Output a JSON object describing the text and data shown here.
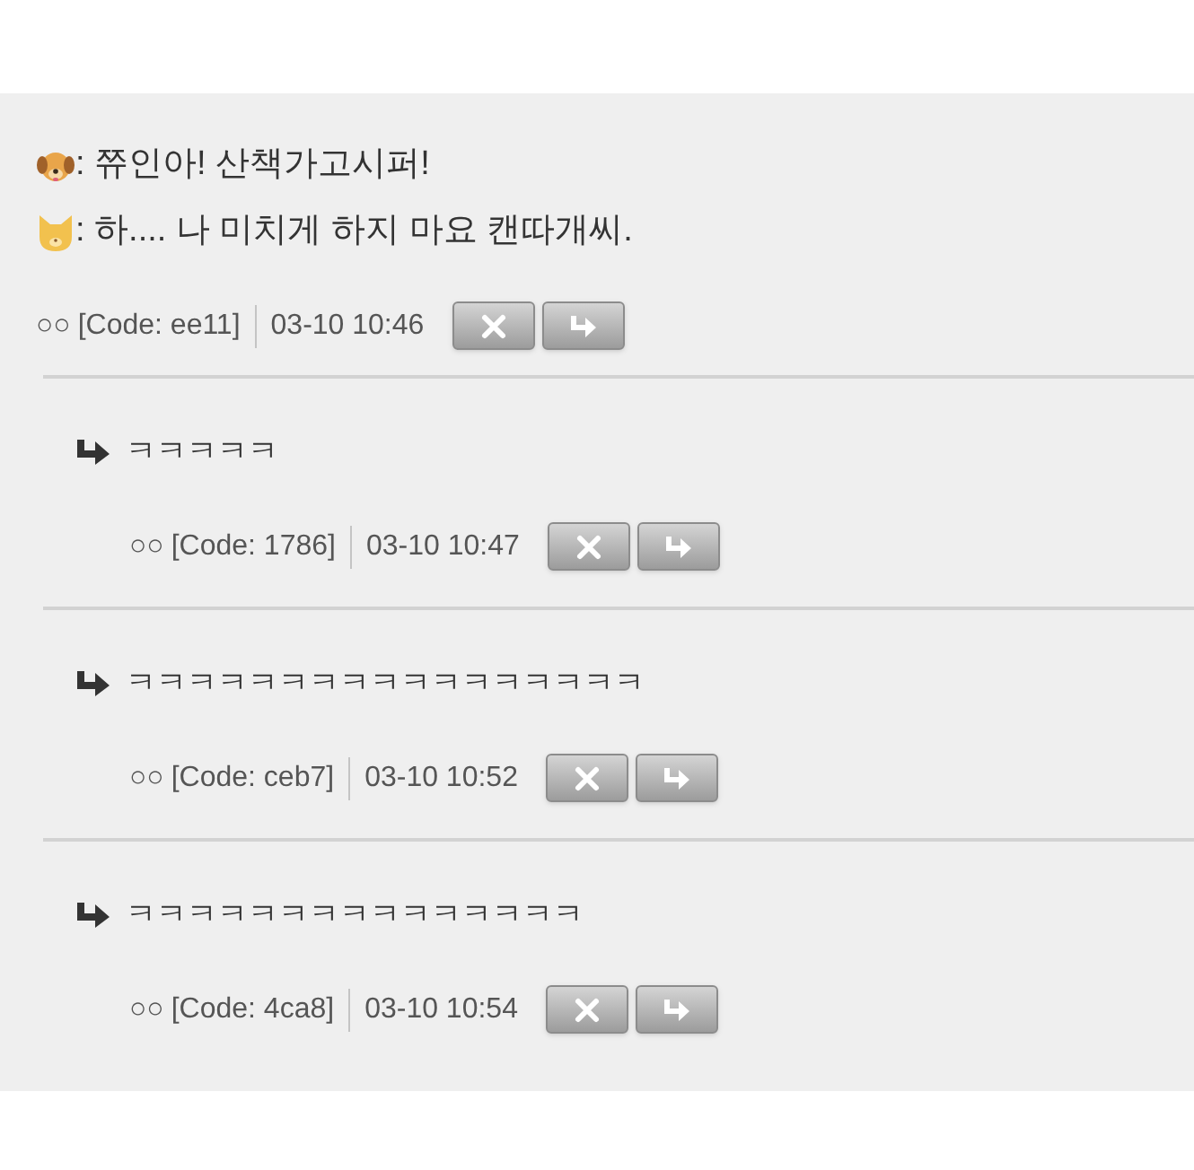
{
  "post": {
    "lines": [
      {
        "kind": "dog",
        "text": ": 쮸인아! 산책가고시퍼!"
      },
      {
        "kind": "cat",
        "text": ": 하.... 나 미치게 하지 마요 캔따개씨."
      }
    ],
    "author": "○○",
    "code": "[Code: ee11]",
    "time": "03-10 10:46"
  },
  "replies": [
    {
      "text": "ㅋㅋㅋㅋㅋ",
      "author": "○○",
      "code": "[Code: 1786]",
      "time": "03-10 10:47"
    },
    {
      "text": "ㅋㅋㅋㅋㅋㅋㅋㅋㅋㅋㅋㅋㅋㅋㅋㅋㅋ",
      "author": "○○",
      "code": "[Code: ceb7]",
      "time": "03-10 10:52"
    },
    {
      "text": "ㅋㅋㅋㅋㅋㅋㅋㅋㅋㅋㅋㅋㅋㅋㅋ",
      "author": "○○",
      "code": "[Code: 4ca8]",
      "time": "03-10 10:54"
    }
  ]
}
